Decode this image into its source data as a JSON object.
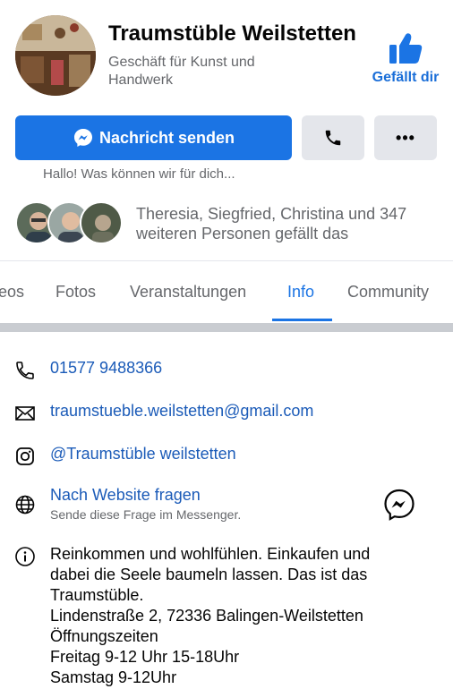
{
  "header": {
    "page_name": "Traumstüble Weilstetten",
    "category": "Geschäft für Kunst und Handwerk",
    "like_label": "Gefällt dir"
  },
  "actions": {
    "message_label": "Nachricht senden",
    "more_label": "•••",
    "greeting": "Hallo! Was können wir für dich..."
  },
  "likes": {
    "text": "Theresia, Siegfried, Christina und 347 weiteren Personen gefällt das"
  },
  "tabs": [
    {
      "label": "eos"
    },
    {
      "label": "Fotos"
    },
    {
      "label": "Veranstaltungen"
    },
    {
      "label": "Info"
    },
    {
      "label": "Community"
    }
  ],
  "info": {
    "phone": "01577 9488366",
    "email": "traumstueble.weilstetten@gmail.com",
    "instagram": "@Traumstüble weilstetten",
    "website_label": "Nach Website fragen",
    "website_sub": "Sende diese Frage im Messenger.",
    "about_lines": [
      "Reinkommen und wohlfühlen.  Einkaufen und",
      "dabei die Seele baumeln lassen. Das ist das",
      "Traumstüble.",
      "Lindenstraße 2, 72336 Balingen-Weilstetten",
      "Öffnungszeiten",
      "Freitag 9-12 Uhr 15-18Uhr",
      "Samstag 9-12Uhr"
    ]
  },
  "colors": {
    "accent": "#1b74e4",
    "link": "#1b5bb8",
    "secondary_text": "#65676b",
    "button_gray": "#e4e6eb"
  }
}
